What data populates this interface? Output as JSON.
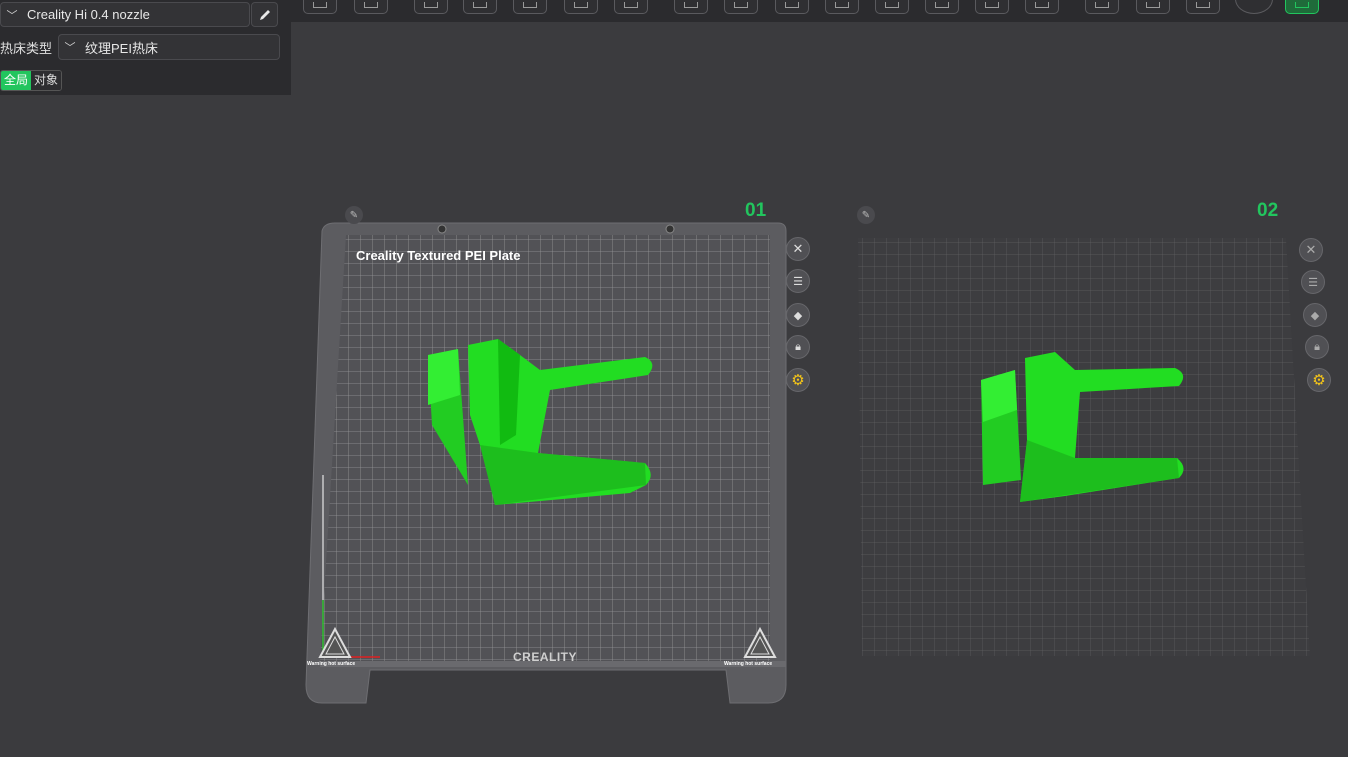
{
  "left_panel": {
    "printer": "Creality Hi 0.4 nozzle",
    "bed_type_label": "热床类型",
    "bed_type_value": "纹理PEI热床",
    "scope_global": "全局",
    "scope_object": "对象"
  },
  "plates": [
    {
      "number": "01",
      "label": "Creality Textured PEI Plate"
    },
    {
      "number": "02"
    }
  ],
  "bed_marks": {
    "brand": "CREALITY",
    "warning": "Warning hot surface"
  },
  "colors": {
    "accent": "#22c55e",
    "model": "#22dd22",
    "background": "#3b3b3e"
  },
  "icons": [
    "chevron-down-icon",
    "pencil-icon",
    "close-icon",
    "list-icon",
    "auto-orient-icon",
    "lock-icon",
    "gear-icon",
    "warning-icon"
  ]
}
